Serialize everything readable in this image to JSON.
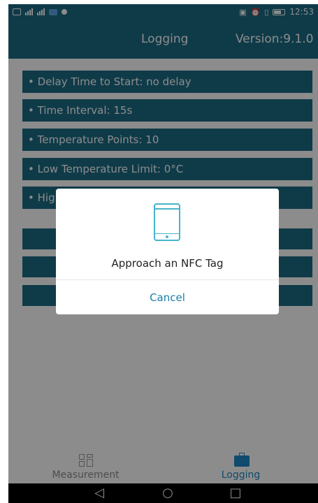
{
  "status_bar": {
    "time": "12:53"
  },
  "header": {
    "title": "Logging",
    "version": "Version:9.1.0"
  },
  "params": [
    {
      "label": "• Delay Time to Start:  no delay"
    },
    {
      "label": "• Time Interval:  15s"
    },
    {
      "label": "• Temperature Points:  10"
    },
    {
      "label": "• Low Temperature Limit:  0°C"
    },
    {
      "label": "• Hig"
    }
  ],
  "dialog": {
    "message": "Approach an NFC Tag",
    "cancel_label": "Cancel"
  },
  "tabs": [
    {
      "label": "Measurement",
      "icon": "grid-icon",
      "active": false
    },
    {
      "label": "Logging",
      "icon": "briefcase-icon",
      "active": true
    }
  ],
  "colors": {
    "primary": "#1d6c85",
    "accent": "#1e88c7",
    "dialog_icon": "#45b5c9"
  }
}
